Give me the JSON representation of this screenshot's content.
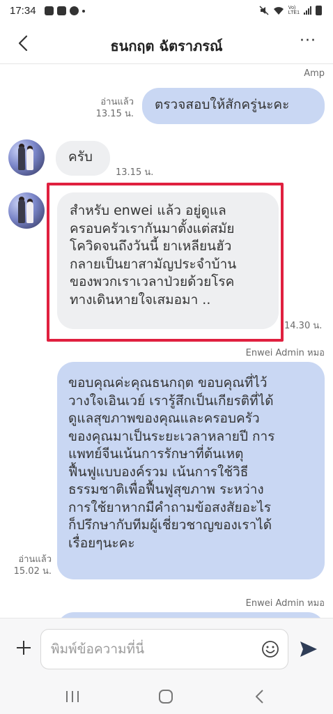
{
  "status_bar": {
    "time": "17:34",
    "network_label": "Vo)\nLTE1"
  },
  "header": {
    "title": "ธนกฤต ฉัตราภรณ์",
    "more_label": "···"
  },
  "messages": [
    {
      "direction": "out",
      "sender": "Amp",
      "text": "ตรวจสอบให้สักครู่นะคะ",
      "read_label": "อ่านแล้ว",
      "time": "13.15 น."
    },
    {
      "direction": "in",
      "text": "ครับ",
      "time": "13.15 น."
    },
    {
      "direction": "in",
      "text": "สำหรับ enwei แล้ว อยู่ดูแล\nครอบครัวเรากันมาตั้งแต่สมัย\nโควิดจนถึงวันนี้ ยาเหลียนฮัว\nกลายเป็นยาสามัญประจำบ้าน\nของพวกเราเวลาป่วยด้วยโรค\nทางเดินหายใจเสมอมา ..",
      "time": "14.30 น.",
      "highlighted": true
    },
    {
      "direction": "out",
      "sender": "Enwei Admin หมอ",
      "text": "ขอบคุณค่ะคุณธนกฤต ขอบคุณที่ไว้\nวางใจเอินเวย์ เรารู้สึกเป็นเกียรติที่ได้\nดูแลสุขภาพของคุณและครอบครัว\nของคุณมาเป็นระยะเวลาหลายปี การ\nแพทย์จีนเน้นการรักษาที่ต้นเหตุ\nฟื้นฟูแบบองค์รวม เน้นการใช้วิธี\nธรรมชาติเพื่อฟื้นฟูสุขภาพ ระหว่าง\nการใช้ยาหากมีคำถามข้อสงสัยอะไร\nก็ปรึกษากับทีมผู้เชี่ยวชาญของเราได้\nเรื่อยๆนะคะ",
      "read_label": "อ่านแล้ว",
      "time": "15.02 น."
    },
    {
      "direction": "out",
      "sender": "Enwei Admin หมอ",
      "text": ""
    }
  ],
  "composer": {
    "placeholder": "พิมพ์ข้อความที่นี่",
    "value": ""
  },
  "icons": {
    "back": "chevron-left-icon",
    "more": "more-horizontal-icon",
    "add": "plus-icon",
    "emoji": "smiley-icon",
    "send": "send-arrow-icon",
    "nav_recents": "recent-apps-icon",
    "nav_home": "home-icon",
    "nav_back": "nav-back-icon"
  },
  "colors": {
    "outgoing_bubble": "#c9d7f3",
    "incoming_bubble": "#eeeff1",
    "highlight_border": "#e0203f"
  }
}
